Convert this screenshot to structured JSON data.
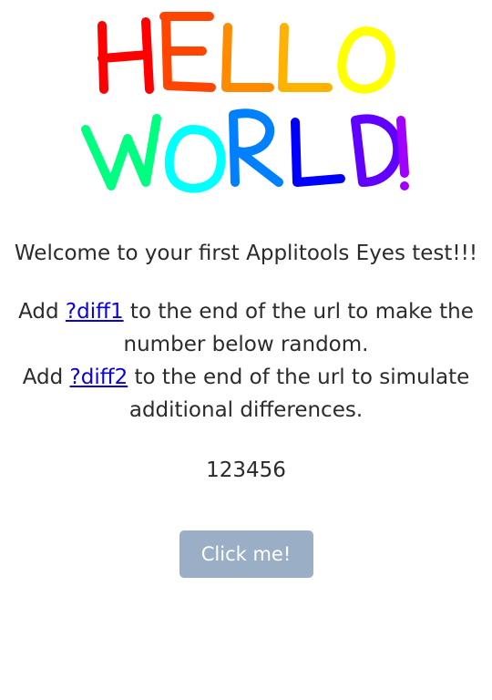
{
  "logo": {
    "alt": "HELLO WORLD!",
    "colors": [
      "#ff0000",
      "#ff4500",
      "#ff8c00",
      "#ffb300",
      "#ffff00",
      "#00ff80",
      "#00ffff",
      "#0080ff",
      "#0000ff",
      "#6000ff",
      "#a000ff"
    ]
  },
  "welcome_text": "Welcome to your first Applitools Eyes test!!!",
  "instructions": [
    {
      "prefix": "Add ",
      "link": "?diff1",
      "suffix": " to the end of the url to make the number below random."
    },
    {
      "prefix": "Add ",
      "link": "?diff2",
      "suffix": " to the end of the url to simulate additional differences."
    }
  ],
  "number": "123456",
  "button_label": "Click me!",
  "colors": {
    "link": "#0b00d8",
    "button_bg": "#9aaec6",
    "text": "#2b2b2b"
  }
}
